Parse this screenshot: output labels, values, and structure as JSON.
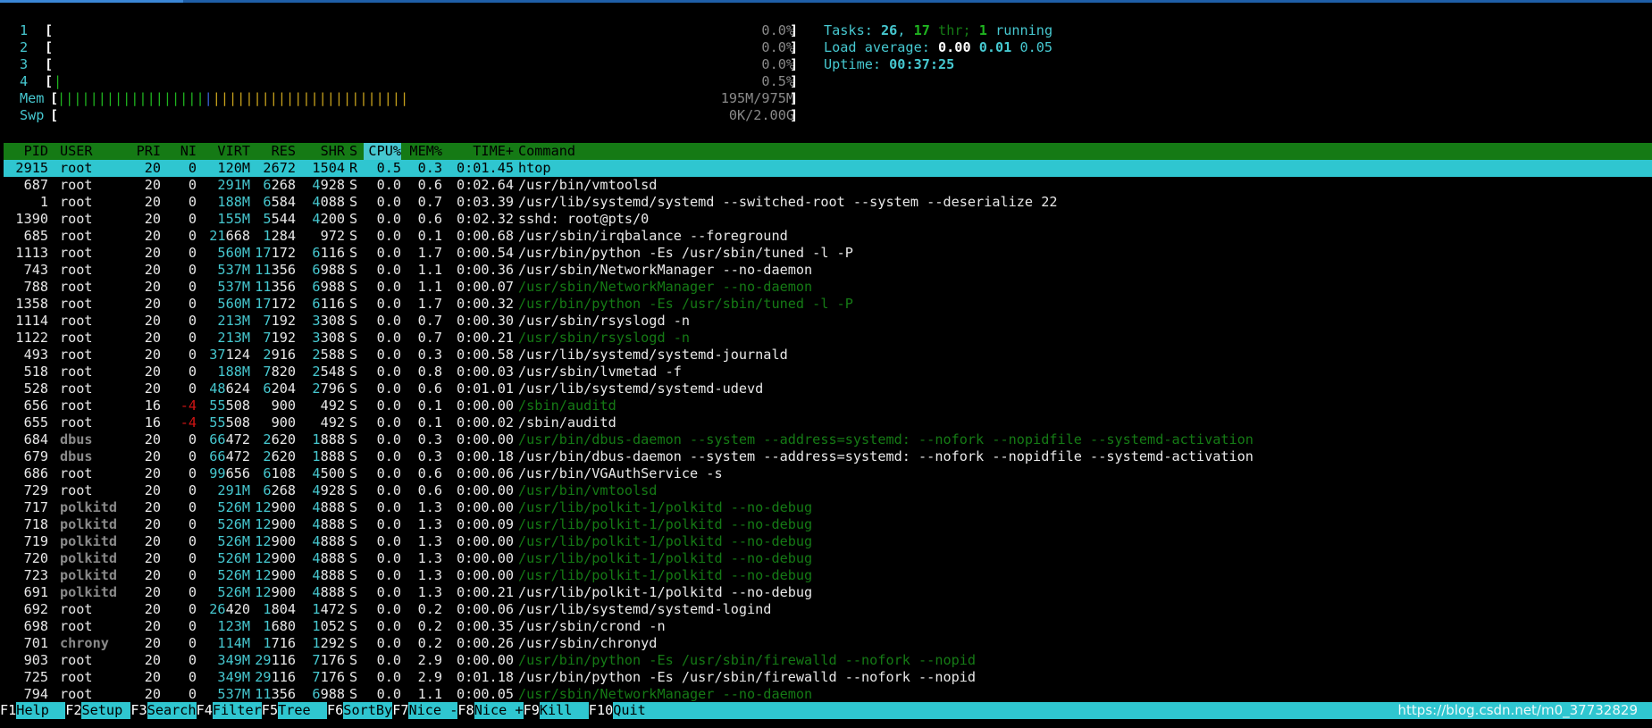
{
  "meters": {
    "cpu": [
      {
        "label": "1",
        "value": "0.0%"
      },
      {
        "label": "2",
        "value": "0.0%"
      },
      {
        "label": "3",
        "value": "0.0%"
      },
      {
        "label": "4",
        "value": "0.5%"
      }
    ],
    "mem": {
      "label": "Mem",
      "value": "195M/975M"
    },
    "swp": {
      "label": "Swp",
      "value": "0K/2.00G"
    }
  },
  "info": {
    "tasks_label": "Tasks: ",
    "tasks": "26",
    "sep1": ", ",
    "threads": "17",
    "thr_label": " thr; ",
    "running": "1",
    "running_label": " running",
    "load_label": "Load average: ",
    "load1": "0.00",
    "load5": "0.01",
    "load15": "0.05",
    "uptime_label": "Uptime: ",
    "uptime": "00:37:25"
  },
  "columns": {
    "pid": "PID",
    "user": "USER",
    "pri": "PRI",
    "ni": "NI",
    "virt": "VIRT",
    "res": "RES",
    "shr": "SHR",
    "s": "S",
    "cpu": "CPU%",
    "mem": "MEM%",
    "time": "TIME+",
    "cmd": "Command"
  },
  "processes": [
    {
      "pid": "2915",
      "user": "root",
      "pri": "20",
      "ni": "0",
      "virt": "120M",
      "res": "2672",
      "shr": "1504",
      "s": "R",
      "cpu": "0.5",
      "mem": "0.3",
      "time": "0:01.45",
      "cmd": "htop",
      "selected": true
    },
    {
      "pid": "687",
      "user": "root",
      "pri": "20",
      "ni": "0",
      "virt": "291M",
      "res": "6268",
      "shr": "4928",
      "s": "S",
      "cpu": "0.0",
      "mem": "0.6",
      "time": "0:02.64",
      "cmd": "/usr/bin/vmtoolsd"
    },
    {
      "pid": "1",
      "user": "root",
      "pri": "20",
      "ni": "0",
      "virt": "188M",
      "res": "6584",
      "shr": "4088",
      "s": "S",
      "cpu": "0.0",
      "mem": "0.7",
      "time": "0:03.39",
      "cmd": "/usr/lib/systemd/systemd --switched-root --system --deserialize 22"
    },
    {
      "pid": "1390",
      "user": "root",
      "pri": "20",
      "ni": "0",
      "virt": "155M",
      "res": "5544",
      "shr": "4200",
      "s": "S",
      "cpu": "0.0",
      "mem": "0.6",
      "time": "0:02.32",
      "cmd": "sshd: root@pts/0"
    },
    {
      "pid": "685",
      "user": "root",
      "pri": "20",
      "ni": "0",
      "virt": "21668",
      "res": "1284",
      "shr": "972",
      "s": "S",
      "cpu": "0.0",
      "mem": "0.1",
      "time": "0:00.68",
      "cmd": "/usr/sbin/irqbalance --foreground"
    },
    {
      "pid": "1113",
      "user": "root",
      "pri": "20",
      "ni": "0",
      "virt": "560M",
      "res": "17172",
      "shr": "6116",
      "s": "S",
      "cpu": "0.0",
      "mem": "1.7",
      "time": "0:00.54",
      "cmd": "/usr/bin/python -Es /usr/sbin/tuned -l -P"
    },
    {
      "pid": "743",
      "user": "root",
      "pri": "20",
      "ni": "0",
      "virt": "537M",
      "res": "11356",
      "shr": "6988",
      "s": "S",
      "cpu": "0.0",
      "mem": "1.1",
      "time": "0:00.36",
      "cmd": "/usr/sbin/NetworkManager --no-daemon"
    },
    {
      "pid": "788",
      "user": "root",
      "pri": "20",
      "ni": "0",
      "virt": "537M",
      "res": "11356",
      "shr": "6988",
      "s": "S",
      "cpu": "0.0",
      "mem": "1.1",
      "time": "0:00.07",
      "cmd": "/usr/sbin/NetworkManager --no-daemon",
      "thread": true
    },
    {
      "pid": "1358",
      "user": "root",
      "pri": "20",
      "ni": "0",
      "virt": "560M",
      "res": "17172",
      "shr": "6116",
      "s": "S",
      "cpu": "0.0",
      "mem": "1.7",
      "time": "0:00.32",
      "cmd": "/usr/bin/python -Es /usr/sbin/tuned -l -P",
      "thread": true
    },
    {
      "pid": "1114",
      "user": "root",
      "pri": "20",
      "ni": "0",
      "virt": "213M",
      "res": "7192",
      "shr": "3308",
      "s": "S",
      "cpu": "0.0",
      "mem": "0.7",
      "time": "0:00.30",
      "cmd": "/usr/sbin/rsyslogd -n"
    },
    {
      "pid": "1122",
      "user": "root",
      "pri": "20",
      "ni": "0",
      "virt": "213M",
      "res": "7192",
      "shr": "3308",
      "s": "S",
      "cpu": "0.0",
      "mem": "0.7",
      "time": "0:00.21",
      "cmd": "/usr/sbin/rsyslogd -n",
      "thread": true
    },
    {
      "pid": "493",
      "user": "root",
      "pri": "20",
      "ni": "0",
      "virt": "37124",
      "res": "2916",
      "shr": "2588",
      "s": "S",
      "cpu": "0.0",
      "mem": "0.3",
      "time": "0:00.58",
      "cmd": "/usr/lib/systemd/systemd-journald"
    },
    {
      "pid": "518",
      "user": "root",
      "pri": "20",
      "ni": "0",
      "virt": "188M",
      "res": "7820",
      "shr": "2548",
      "s": "S",
      "cpu": "0.0",
      "mem": "0.8",
      "time": "0:00.03",
      "cmd": "/usr/sbin/lvmetad -f"
    },
    {
      "pid": "528",
      "user": "root",
      "pri": "20",
      "ni": "0",
      "virt": "48624",
      "res": "6204",
      "shr": "2796",
      "s": "S",
      "cpu": "0.0",
      "mem": "0.6",
      "time": "0:01.01",
      "cmd": "/usr/lib/systemd/systemd-udevd"
    },
    {
      "pid": "656",
      "user": "root",
      "pri": "16",
      "ni": "-4",
      "virt": "55508",
      "res": "900",
      "shr": "492",
      "s": "S",
      "cpu": "0.0",
      "mem": "0.1",
      "time": "0:00.00",
      "cmd": "/sbin/auditd",
      "thread": true
    },
    {
      "pid": "655",
      "user": "root",
      "pri": "16",
      "ni": "-4",
      "virt": "55508",
      "res": "900",
      "shr": "492",
      "s": "S",
      "cpu": "0.0",
      "mem": "0.1",
      "time": "0:00.02",
      "cmd": "/sbin/auditd"
    },
    {
      "pid": "684",
      "user": "dbus",
      "pri": "20",
      "ni": "0",
      "virt": "66472",
      "res": "2620",
      "shr": "1888",
      "s": "S",
      "cpu": "0.0",
      "mem": "0.3",
      "time": "0:00.00",
      "cmd": "/usr/bin/dbus-daemon --system --address=systemd: --nofork --nopidfile --systemd-activation",
      "thread": true
    },
    {
      "pid": "679",
      "user": "dbus",
      "pri": "20",
      "ni": "0",
      "virt": "66472",
      "res": "2620",
      "shr": "1888",
      "s": "S",
      "cpu": "0.0",
      "mem": "0.3",
      "time": "0:00.18",
      "cmd": "/usr/bin/dbus-daemon --system --address=systemd: --nofork --nopidfile --systemd-activation"
    },
    {
      "pid": "686",
      "user": "root",
      "pri": "20",
      "ni": "0",
      "virt": "99656",
      "res": "6108",
      "shr": "4500",
      "s": "S",
      "cpu": "0.0",
      "mem": "0.6",
      "time": "0:00.06",
      "cmd": "/usr/bin/VGAuthService -s"
    },
    {
      "pid": "729",
      "user": "root",
      "pri": "20",
      "ni": "0",
      "virt": "291M",
      "res": "6268",
      "shr": "4928",
      "s": "S",
      "cpu": "0.0",
      "mem": "0.6",
      "time": "0:00.00",
      "cmd": "/usr/bin/vmtoolsd",
      "thread": true
    },
    {
      "pid": "717",
      "user": "polkitd",
      "pri": "20",
      "ni": "0",
      "virt": "526M",
      "res": "12900",
      "shr": "4888",
      "s": "S",
      "cpu": "0.0",
      "mem": "1.3",
      "time": "0:00.00",
      "cmd": "/usr/lib/polkit-1/polkitd --no-debug",
      "thread": true
    },
    {
      "pid": "718",
      "user": "polkitd",
      "pri": "20",
      "ni": "0",
      "virt": "526M",
      "res": "12900",
      "shr": "4888",
      "s": "S",
      "cpu": "0.0",
      "mem": "1.3",
      "time": "0:00.09",
      "cmd": "/usr/lib/polkit-1/polkitd --no-debug",
      "thread": true
    },
    {
      "pid": "719",
      "user": "polkitd",
      "pri": "20",
      "ni": "0",
      "virt": "526M",
      "res": "12900",
      "shr": "4888",
      "s": "S",
      "cpu": "0.0",
      "mem": "1.3",
      "time": "0:00.00",
      "cmd": "/usr/lib/polkit-1/polkitd --no-debug",
      "thread": true
    },
    {
      "pid": "720",
      "user": "polkitd",
      "pri": "20",
      "ni": "0",
      "virt": "526M",
      "res": "12900",
      "shr": "4888",
      "s": "S",
      "cpu": "0.0",
      "mem": "1.3",
      "time": "0:00.00",
      "cmd": "/usr/lib/polkit-1/polkitd --no-debug",
      "thread": true
    },
    {
      "pid": "723",
      "user": "polkitd",
      "pri": "20",
      "ni": "0",
      "virt": "526M",
      "res": "12900",
      "shr": "4888",
      "s": "S",
      "cpu": "0.0",
      "mem": "1.3",
      "time": "0:00.00",
      "cmd": "/usr/lib/polkit-1/polkitd --no-debug",
      "thread": true
    },
    {
      "pid": "691",
      "user": "polkitd",
      "pri": "20",
      "ni": "0",
      "virt": "526M",
      "res": "12900",
      "shr": "4888",
      "s": "S",
      "cpu": "0.0",
      "mem": "1.3",
      "time": "0:00.21",
      "cmd": "/usr/lib/polkit-1/polkitd --no-debug"
    },
    {
      "pid": "692",
      "user": "root",
      "pri": "20",
      "ni": "0",
      "virt": "26420",
      "res": "1804",
      "shr": "1472",
      "s": "S",
      "cpu": "0.0",
      "mem": "0.2",
      "time": "0:00.06",
      "cmd": "/usr/lib/systemd/systemd-logind"
    },
    {
      "pid": "698",
      "user": "root",
      "pri": "20",
      "ni": "0",
      "virt": "123M",
      "res": "1680",
      "shr": "1052",
      "s": "S",
      "cpu": "0.0",
      "mem": "0.2",
      "time": "0:00.35",
      "cmd": "/usr/sbin/crond -n"
    },
    {
      "pid": "701",
      "user": "chrony",
      "pri": "20",
      "ni": "0",
      "virt": "114M",
      "res": "1716",
      "shr": "1292",
      "s": "S",
      "cpu": "0.0",
      "mem": "0.2",
      "time": "0:00.26",
      "cmd": "/usr/sbin/chronyd"
    },
    {
      "pid": "903",
      "user": "root",
      "pri": "20",
      "ni": "0",
      "virt": "349M",
      "res": "29116",
      "shr": "7176",
      "s": "S",
      "cpu": "0.0",
      "mem": "2.9",
      "time": "0:00.00",
      "cmd": "/usr/bin/python -Es /usr/sbin/firewalld --nofork --nopid",
      "thread": true
    },
    {
      "pid": "725",
      "user": "root",
      "pri": "20",
      "ni": "0",
      "virt": "349M",
      "res": "29116",
      "shr": "7176",
      "s": "S",
      "cpu": "0.0",
      "mem": "2.9",
      "time": "0:01.18",
      "cmd": "/usr/bin/python -Es /usr/sbin/firewalld --nofork --nopid"
    },
    {
      "pid": "794",
      "user": "root",
      "pri": "20",
      "ni": "0",
      "virt": "537M",
      "res": "11356",
      "shr": "6988",
      "s": "S",
      "cpu": "0.0",
      "mem": "1.1",
      "time": "0:00.05",
      "cmd": "/usr/sbin/NetworkManager --no-daemon",
      "thread": true
    }
  ],
  "footer": [
    {
      "key": "F1",
      "label": "Help  "
    },
    {
      "key": "F2",
      "label": "Setup "
    },
    {
      "key": "F3",
      "label": "Search"
    },
    {
      "key": "F4",
      "label": "Filter"
    },
    {
      "key": "F5",
      "label": "Tree  "
    },
    {
      "key": "F6",
      "label": "SortBy"
    },
    {
      "key": "F7",
      "label": "Nice -"
    },
    {
      "key": "F8",
      "label": "Nice +"
    },
    {
      "key": "F9",
      "label": "Kill  "
    },
    {
      "key": "F10",
      "label": "Quit  "
    }
  ],
  "watermark": "https://blog.csdn.net/m0_37732829",
  "colors": {
    "header_bg": "#157a15",
    "selected_bg": "#2fc6d0",
    "accent": "#46c8d0"
  }
}
